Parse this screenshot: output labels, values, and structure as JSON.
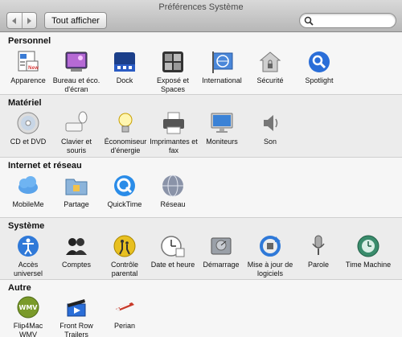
{
  "window": {
    "title": "Préférences Système",
    "show_all": "Tout afficher",
    "search_placeholder": "",
    "search_value": ""
  },
  "sections": [
    {
      "title": "Personnel",
      "items": [
        {
          "label": "Apparence",
          "icon": "appearance-icon"
        },
        {
          "label": "Bureau et éco. d'écran",
          "icon": "desktop-screensaver-icon"
        },
        {
          "label": "Dock",
          "icon": "dock-icon"
        },
        {
          "label": "Exposé et Spaces",
          "icon": "expose-spaces-icon"
        },
        {
          "label": "International",
          "icon": "international-icon"
        },
        {
          "label": "Sécurité",
          "icon": "security-icon"
        },
        {
          "label": "Spotlight",
          "icon": "spotlight-icon"
        }
      ]
    },
    {
      "title": "Matériel",
      "items": [
        {
          "label": "CD et DVD",
          "icon": "cd-dvd-icon"
        },
        {
          "label": "Clavier et souris",
          "icon": "keyboard-mouse-icon"
        },
        {
          "label": "Économiseur d'énergie",
          "icon": "energy-saver-icon"
        },
        {
          "label": "Imprimantes et fax",
          "icon": "printer-icon"
        },
        {
          "label": "Moniteurs",
          "icon": "displays-icon"
        },
        {
          "label": "Son",
          "icon": "sound-icon"
        }
      ]
    },
    {
      "title": "Internet et réseau",
      "items": [
        {
          "label": "MobileMe",
          "icon": "mobileme-icon"
        },
        {
          "label": "Partage",
          "icon": "sharing-icon"
        },
        {
          "label": "QuickTime",
          "icon": "quicktime-icon"
        },
        {
          "label": "Réseau",
          "icon": "network-icon"
        }
      ]
    },
    {
      "title": "Système",
      "items": [
        {
          "label": "Accès universel",
          "icon": "universal-access-icon"
        },
        {
          "label": "Comptes",
          "icon": "accounts-icon"
        },
        {
          "label": "Contrôle parental",
          "icon": "parental-controls-icon"
        },
        {
          "label": "Date et heure",
          "icon": "date-time-icon"
        },
        {
          "label": "Démarrage",
          "icon": "startup-disk-icon"
        },
        {
          "label": "Mise à jour de logiciels",
          "icon": "software-update-icon"
        },
        {
          "label": "Parole",
          "icon": "speech-icon"
        },
        {
          "label": "Time Machine",
          "icon": "time-machine-icon"
        }
      ]
    },
    {
      "title": "Autre",
      "items": [
        {
          "label": "Flip4Mac WMV",
          "icon": "flip4mac-icon"
        },
        {
          "label": "Front Row Trailers",
          "icon": "front-row-trailers-icon"
        },
        {
          "label": "Perian",
          "icon": "perian-icon"
        }
      ]
    }
  ]
}
